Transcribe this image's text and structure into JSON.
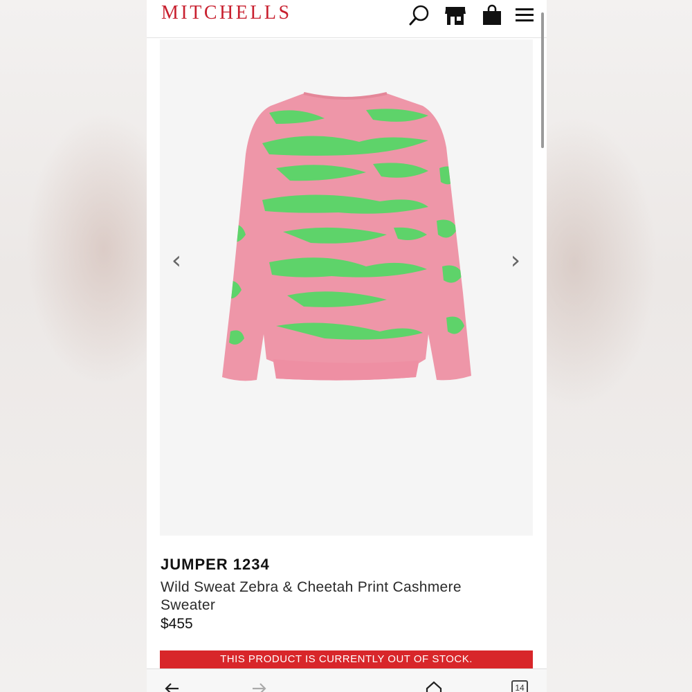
{
  "header": {
    "brand": "MITCHELLS",
    "icons": [
      "search-icon",
      "store-icon",
      "bag-icon",
      "menu-icon"
    ]
  },
  "gallery": {
    "prev_label": "‹",
    "next_label": "›"
  },
  "product": {
    "name": "JUMPER 1234",
    "description": "Wild Sweat Zebra & Cheetah Print Cashmere Sweater",
    "price": "$455"
  },
  "stock_notice": "THIS PRODUCT IS CURRENTLY OUT OF STOCK.",
  "browser": {
    "tab_count": "14",
    "icons": [
      "back-icon",
      "forward-icon",
      "home-icon",
      "tabs-icon"
    ]
  },
  "colors": {
    "brand_red": "#c8202f",
    "notice_red": "#d8262a",
    "sweater_pink": "#ee96a8",
    "sweater_green": "#5ed36a"
  }
}
